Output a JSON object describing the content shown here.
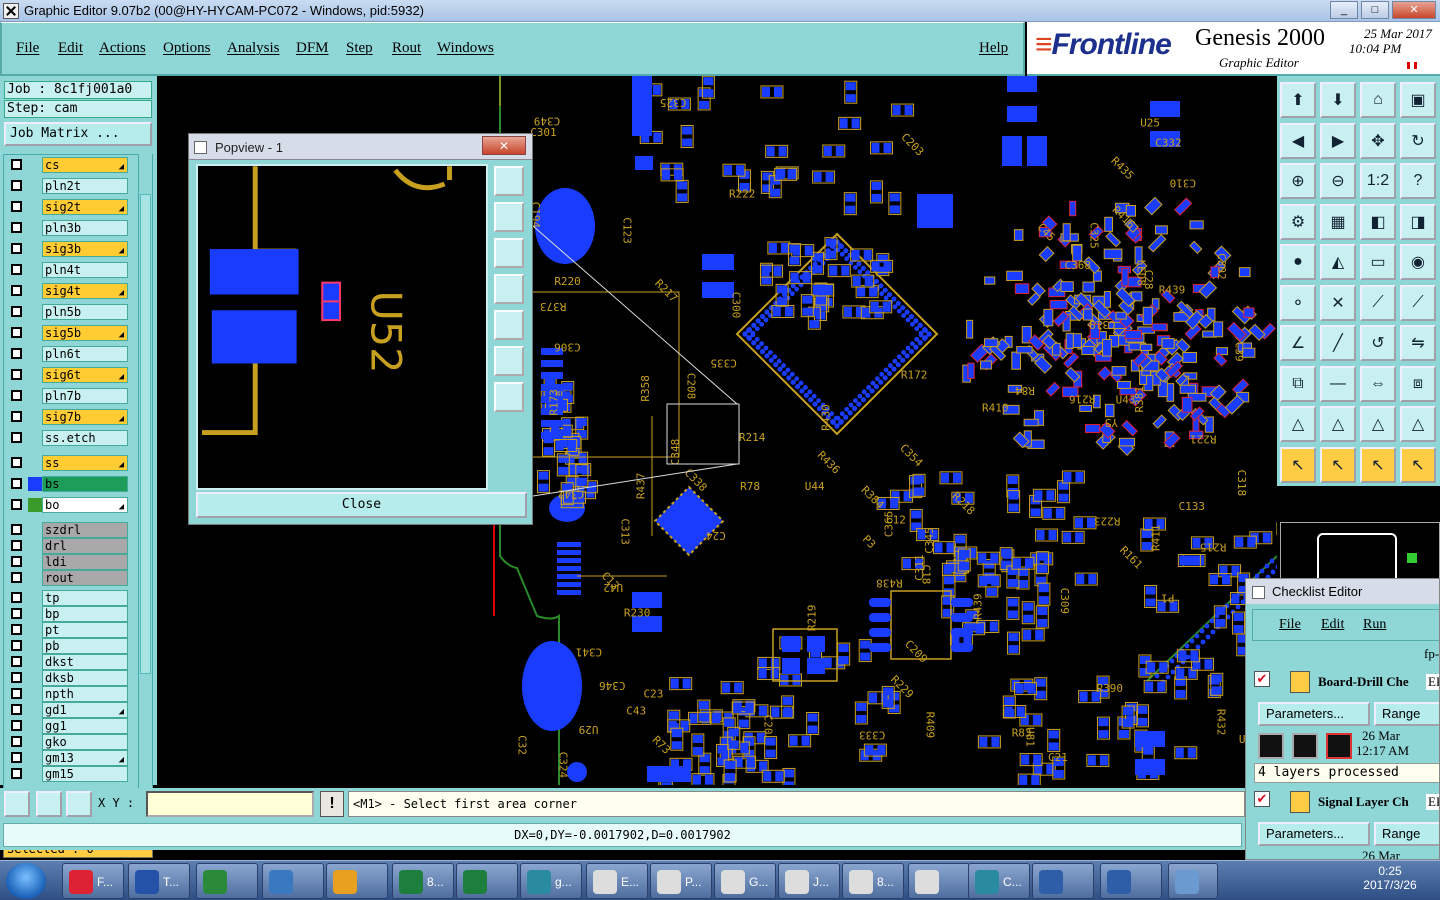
{
  "window": {
    "title": "Graphic Editor 9.07b2 (00@HY-HYCAM-PC072 - Windows, pid:5932)",
    "min": "_",
    "max": "□",
    "close": "✕"
  },
  "menu": [
    "File",
    "Edit",
    "Actions",
    "Options",
    "Analysis",
    "DFM",
    "Step",
    "Rout",
    "Windows"
  ],
  "help": "Help",
  "brand": {
    "logo": "Frontline",
    "product": "Genesis 2000",
    "subtitle": "Graphic Editor",
    "date": "25 Mar 2017",
    "time": "10:04 PM"
  },
  "job": "Job : 8c1fj001a0",
  "step": "Step: cam",
  "job_matrix": "Job Matrix ...",
  "layers": [
    {
      "name": "cs",
      "style": "sig",
      "arrow": true
    },
    {
      "name": "pln2t",
      "style": "plain"
    },
    {
      "name": "sig2t",
      "style": "sig",
      "arrow": true
    },
    {
      "name": "pln3b",
      "style": "plain"
    },
    {
      "name": "sig3b",
      "style": "sig",
      "arrow": true
    },
    {
      "name": "pln4t",
      "style": "plain"
    },
    {
      "name": "sig4t",
      "style": "sig",
      "arrow": true
    },
    {
      "name": "pln5b",
      "style": "plain"
    },
    {
      "name": "sig5b",
      "style": "sig",
      "arrow": true
    },
    {
      "name": "pln6t",
      "style": "plain"
    },
    {
      "name": "sig6t",
      "style": "sig",
      "arrow": true
    },
    {
      "name": "pln7b",
      "style": "plain"
    },
    {
      "name": "sig7b",
      "style": "sig",
      "arrow": true
    },
    {
      "name": "ss.etch",
      "style": "plain"
    },
    {
      "name": "ss",
      "style": "sig",
      "arrow": true
    },
    {
      "name": "bs",
      "style": "green",
      "swatch": "#1a3cff"
    },
    {
      "name": "bo",
      "style": "white",
      "swatch": "#3a9a2a",
      "arrow": true
    },
    {
      "name": "szdrl",
      "style": "grey"
    },
    {
      "name": "drl",
      "style": "grey"
    },
    {
      "name": "ldi",
      "style": "grey"
    },
    {
      "name": "rout",
      "style": "grey"
    },
    {
      "name": "tp",
      "style": "plain"
    },
    {
      "name": "bp",
      "style": "plain"
    },
    {
      "name": "pt",
      "style": "plain"
    },
    {
      "name": "pb",
      "style": "plain"
    },
    {
      "name": "dkst",
      "style": "plain"
    },
    {
      "name": "dksb",
      "style": "plain"
    },
    {
      "name": "npth",
      "style": "plain"
    },
    {
      "name": "gd1",
      "style": "plain",
      "arrow": true
    },
    {
      "name": "gg1",
      "style": "plain"
    },
    {
      "name": "gko",
      "style": "plain"
    },
    {
      "name": "gm13",
      "style": "plain",
      "arrow": true
    },
    {
      "name": "gm15",
      "style": "plain"
    }
  ],
  "selected": "Selected : 0",
  "popview": {
    "title": "Popview - 1",
    "close": "Close",
    "label": "U52"
  },
  "status": {
    "xy_label": "X Y :",
    "xy_value": "",
    "message": "<M1> - Select first area corner",
    "dx": "DX=0,DY=-0.0017902,D=0.0017902"
  },
  "checklist": {
    "title": "Checklist Editor",
    "menu": [
      "File",
      "Edit",
      "Run"
    ],
    "fp": "fp-",
    "items": [
      {
        "name": "Board-Drill Che",
        "status": "ER",
        "params": "Parameters...",
        "range": "Range",
        "date": "26 Mar",
        "time": "12:17 AM",
        "processed": "4 layers processed"
      },
      {
        "name": "Signal Layer Ch",
        "status": "ER",
        "params": "Parameters...",
        "range": "Range",
        "date": "26 Mar"
      }
    ]
  },
  "canvas_labels": [
    "R373",
    "C335",
    "C325",
    "C310",
    "C313",
    "C332",
    "C333",
    "R384",
    "R358",
    "C324",
    "C354",
    "C318",
    "R381",
    "C18",
    "C12",
    "C13",
    "C319",
    "C32",
    "U29",
    "C311",
    "C309",
    "C306",
    "C301",
    "C302",
    "C300",
    "P3",
    "P1",
    "U41",
    "U42",
    "U43",
    "U44",
    "R214",
    "R215",
    "R216",
    "R217",
    "R218",
    "R219",
    "R220",
    "R221",
    "R229",
    "R230",
    "C24",
    "C20",
    "C21",
    "C28",
    "C123",
    "C194",
    "C133",
    "R73",
    "R78",
    "R83",
    "R84",
    "Y3",
    "R430",
    "R432",
    "R435",
    "R436",
    "R437",
    "R438",
    "R439",
    "R439",
    "C348",
    "C349",
    "C345",
    "C346",
    "C325",
    "C338",
    "R409",
    "R410",
    "R411",
    "U81",
    "C365",
    "C368",
    "R416",
    "C341",
    "C342",
    "C43",
    "C45",
    "C23",
    "C39",
    "C203",
    "C208",
    "C209",
    "R161",
    "R172",
    "R173",
    "LED8",
    "R222",
    "R223",
    "U25",
    "R390"
  ],
  "taskbar": {
    "items": [
      {
        "label": "F...",
        "color": "#d23"
      },
      {
        "label": "T...",
        "color": "#2452a8"
      },
      {
        "label": "",
        "color": "#2a8a3a"
      },
      {
        "label": "",
        "color": "#3a78c0"
      },
      {
        "label": "",
        "color": "#e8a020"
      },
      {
        "label": "8...",
        "color": "#1e7e3e"
      },
      {
        "label": "",
        "color": "#1e7e3e"
      },
      {
        "label": "g...",
        "color": "#2a8aa0"
      },
      {
        "label": "E...",
        "color": "#ddd"
      },
      {
        "label": "P...",
        "color": "#ddd"
      },
      {
        "label": "G...",
        "color": "#ddd"
      },
      {
        "label": "J...",
        "color": "#ddd"
      },
      {
        "label": "8...",
        "color": "#ddd"
      },
      {
        "label": "",
        "color": "#ddd"
      },
      {
        "label": "C...",
        "color": "#2a8aa0"
      },
      {
        "label": "",
        "color": "#2e5ea8"
      },
      {
        "label": "",
        "color": "#2e5ea8"
      },
      {
        "label": "",
        "color": "#6a9ad0"
      }
    ],
    "time": "0:25",
    "date": "2017/3/26"
  }
}
